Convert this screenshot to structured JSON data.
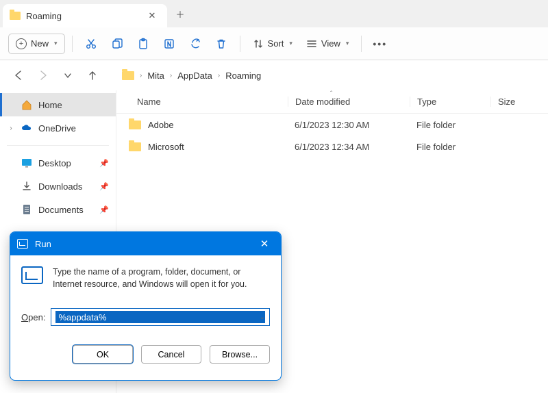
{
  "tab": {
    "title": "Roaming"
  },
  "toolbar": {
    "new_label": "New",
    "sort_label": "Sort",
    "view_label": "View"
  },
  "breadcrumb": {
    "items": [
      "Mita",
      "AppData",
      "Roaming"
    ]
  },
  "sidebar": {
    "home": "Home",
    "onedrive": "OneDrive",
    "desktop": "Desktop",
    "downloads": "Downloads",
    "documents": "Documents"
  },
  "columns": {
    "name": "Name",
    "date": "Date modified",
    "type": "Type",
    "size": "Size"
  },
  "files": [
    {
      "name": "Adobe",
      "date": "6/1/2023 12:30 AM",
      "type": "File folder"
    },
    {
      "name": "Microsoft",
      "date": "6/1/2023 12:34 AM",
      "type": "File folder"
    }
  ],
  "run": {
    "title": "Run",
    "description": "Type the name of a program, folder, document, or Internet resource, and Windows will open it for you.",
    "open_label_pre": "O",
    "open_label_rest": "pen:",
    "value": "%appdata%",
    "ok": "OK",
    "cancel": "Cancel",
    "browse": "Browse..."
  }
}
